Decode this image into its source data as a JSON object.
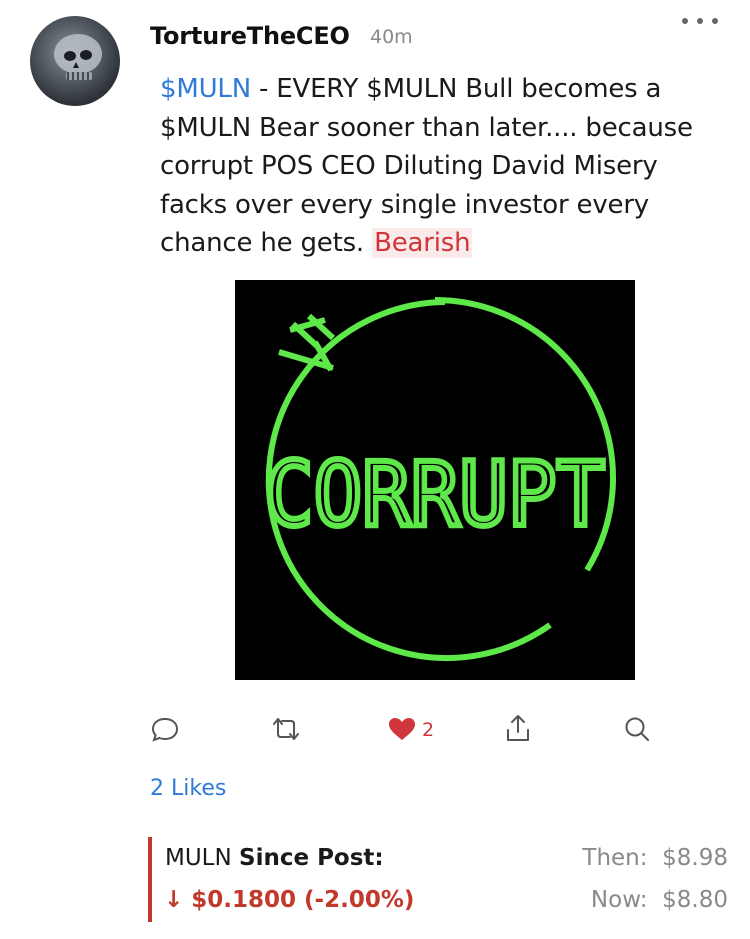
{
  "post": {
    "username": "TortureTheCEO",
    "time": "40m",
    "body": {
      "ticker": "$MULN",
      "text": " - EVERY $MULN Bull becomes a $MULN Bear sooner than later.... because corrupt POS CEO Diluting David Misery facks over every single investor every chance he gets. ",
      "sentiment": "Bearish"
    },
    "image": {
      "word": "CORRUPT",
      "accent": "#5ee84a",
      "background": "#000000"
    }
  },
  "actions": {
    "icons": [
      "comment-icon",
      "reshare-icon",
      "heart-icon",
      "share-icon",
      "search-icon"
    ],
    "like_count": "2",
    "likes_link": "2 Likes"
  },
  "quote": {
    "symbol": "MULN",
    "since_label": "Since Post:",
    "change": "↓ $0.1800  (-2.00%)",
    "then_label": "Then:",
    "then_value": "$8.98",
    "now_label": "Now:",
    "now_value": "$8.80",
    "colors": {
      "down": "#c0392b",
      "link": "#2f7bd8",
      "heart": "#d0353b"
    }
  }
}
